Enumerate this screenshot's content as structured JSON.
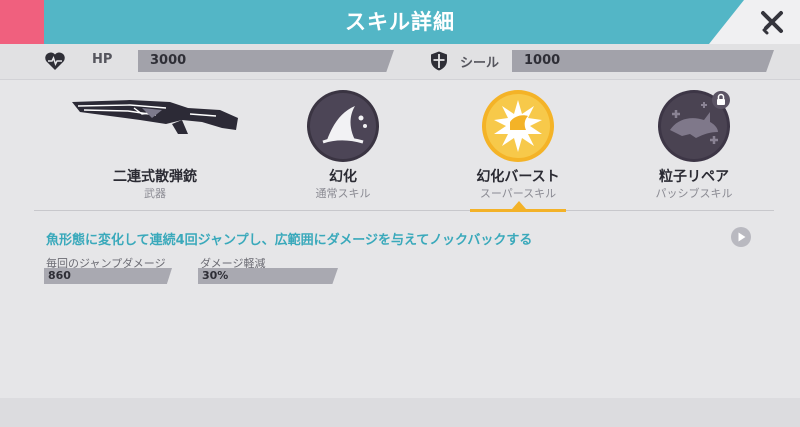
{
  "header": {
    "title": "スキル詳細",
    "close_icon": "close-x-icon",
    "colors": {
      "pink": "#f0607e",
      "teal": "#53b6c6"
    }
  },
  "stats": {
    "hp": {
      "icon": "heart-pulse-icon",
      "label": "HP",
      "value": "3000"
    },
    "shield": {
      "icon": "shield-icon",
      "label": "シール",
      "value": "1000"
    }
  },
  "skills": [
    {
      "name": "二連式散弾銃",
      "sub": "武器",
      "icon": "shotgun-icon",
      "active": false,
      "locked": false
    },
    {
      "name": "幻化",
      "sub": "通常スキル",
      "icon": "shark-fin-icon",
      "active": false,
      "locked": false
    },
    {
      "name": "幻化バースト",
      "sub": "スーパースキル",
      "icon": "shark-burst-icon",
      "active": true,
      "locked": false
    },
    {
      "name": "粒子リペア",
      "sub": "パッシブスキル",
      "icon": "shark-repair-icon",
      "active": false,
      "locked": true
    }
  ],
  "detail": {
    "description": "魚形態に変化して連続4回ジャンプし、広範囲にダメージを与えてノックバックする",
    "play_icon": "play-icon",
    "params": [
      {
        "label": "毎回のジャンプダメージ",
        "value": "860"
      },
      {
        "label": "ダメージ軽減",
        "value": "30%"
      }
    ]
  },
  "accent_color": "#f3b228"
}
